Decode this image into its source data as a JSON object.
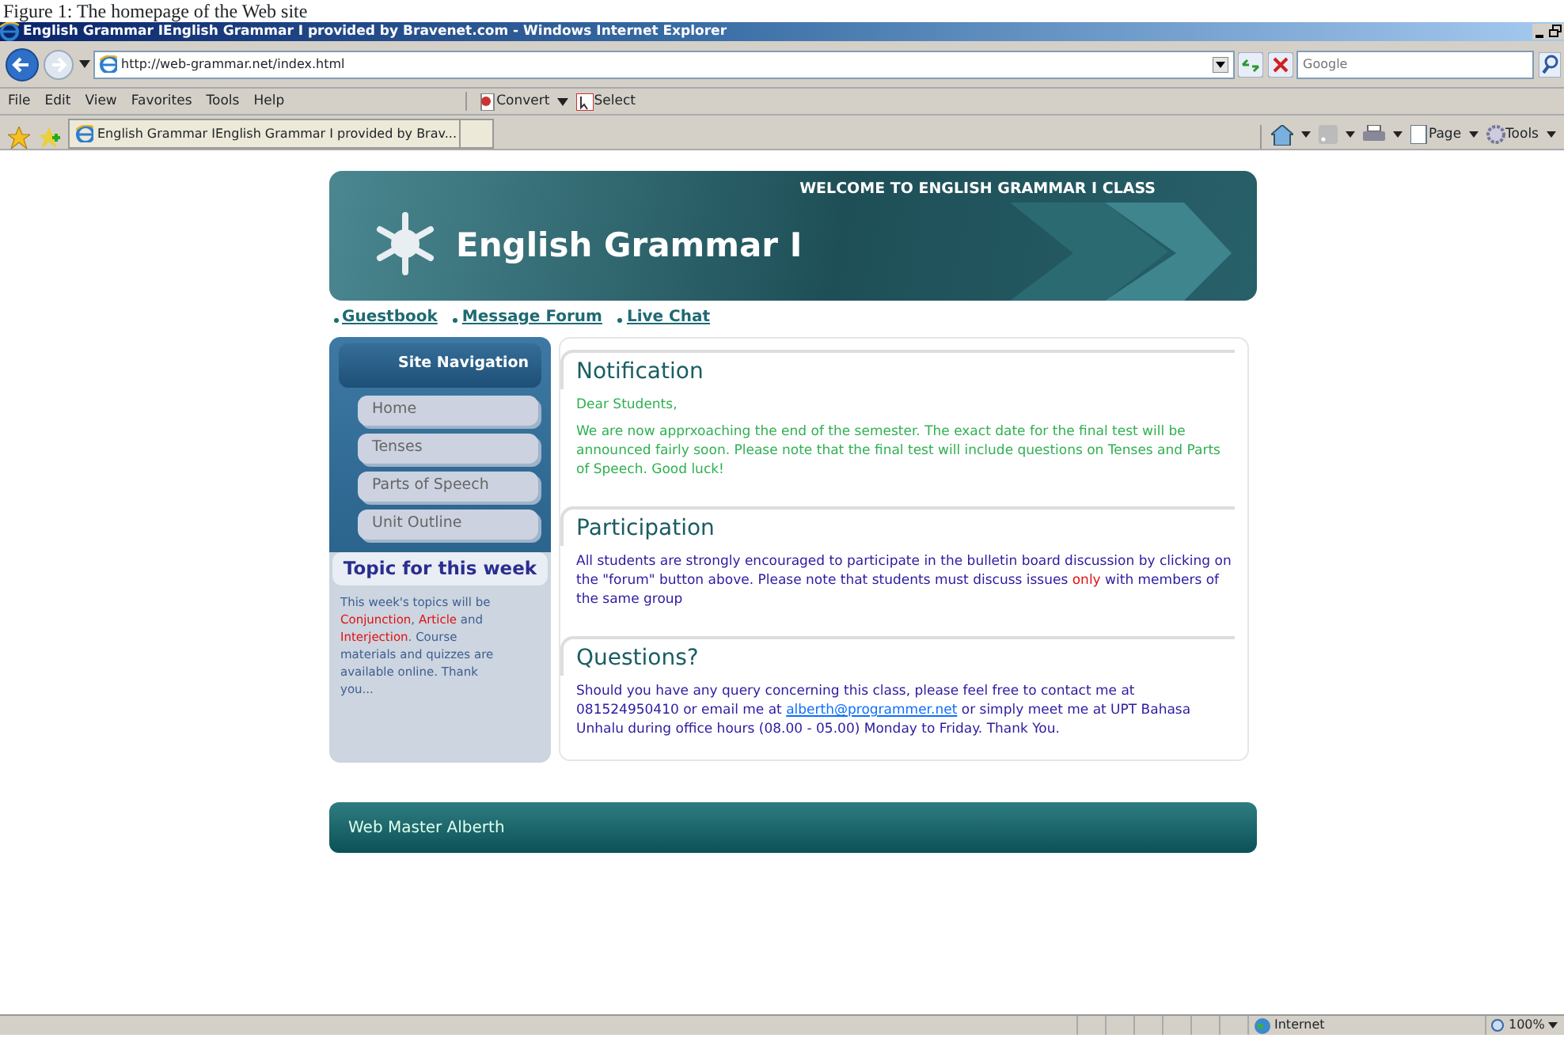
{
  "caption": "Figure 1: The homepage of the Web site",
  "window": {
    "title": "English Grammar IEnglish Grammar I provided by Bravenet.com - Windows Internet Explorer"
  },
  "address": {
    "value": "http://web-grammar.net/index.html"
  },
  "search": {
    "placeholder": "Google"
  },
  "menu": [
    "File",
    "Edit",
    "View",
    "Favorites",
    "Tools",
    "Help"
  ],
  "toolbar": [
    "Convert",
    "Select"
  ],
  "tab": {
    "title": "English Grammar IEnglish Grammar I provided by Brav..."
  },
  "command_bar": [
    "Page",
    "Tools"
  ],
  "page": {
    "banner": {
      "welcome": "WELCOME TO ENGLISH GRAMMAR I CLASS",
      "title": "English Grammar I"
    },
    "links": [
      "Guestbook",
      "Message Forum",
      "Live Chat"
    ],
    "sidebar": {
      "heading": "Site Navigation",
      "items": [
        "Home",
        "Tenses",
        "Parts of Speech",
        "Unit Outline"
      ],
      "topic_heading": "Topic for this week",
      "topic_text": [
        {
          "text": "This week's topics will be ",
          "highlight": false
        },
        {
          "text": "Conjunction",
          "highlight": true
        },
        {
          "text": ", ",
          "highlight": false
        },
        {
          "text": "Article",
          "highlight": true
        },
        {
          "text": " and ",
          "highlight": false
        },
        {
          "text": "Interjection",
          "highlight": true
        },
        {
          "text": ". Course materials and quizzes are available online. Thank you...",
          "highlight": false
        }
      ]
    },
    "sections": [
      {
        "heading": "Notification",
        "kind": "notice",
        "paragraphs": [
          [
            {
              "text": "Dear Students,",
              "kind": "plain"
            }
          ],
          [
            {
              "text": "We are now apprxoaching the end of the semester. The exact date for the final test will be announced fairly soon. Please note that the final test will include questions on Tenses and Parts of Speech. Good luck!",
              "kind": "plain"
            }
          ]
        ]
      },
      {
        "heading": "Participation",
        "kind": "info",
        "paragraphs": [
          [
            {
              "text": "All students are strongly encouraged to participate in the bulletin board discussion by clicking on the \"forum\" button above. Please note that students must discuss issues ",
              "kind": "plain"
            },
            {
              "text": "only",
              "kind": "highlight"
            },
            {
              "text": " with members of the same group",
              "kind": "plain"
            }
          ]
        ]
      },
      {
        "heading": "Questions?",
        "kind": "info",
        "paragraphs": [
          [
            {
              "text": "Should you have any query concerning this class, please feel free to contact me at 081524950410 or email me at ",
              "kind": "plain"
            },
            {
              "text": "alberth@programmer.net",
              "kind": "link"
            },
            {
              "text": " or simply meet me at UPT Bahasa Unhalu during office hours (08.00 - 05.00) Monday to Friday. Thank You.",
              "kind": "plain"
            }
          ]
        ]
      }
    ],
    "footer": "Web Master Alberth"
  },
  "status_bar": {
    "zone": "Internet",
    "zoom": "100%"
  }
}
